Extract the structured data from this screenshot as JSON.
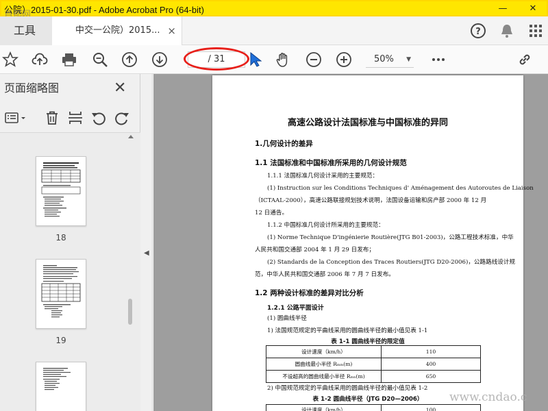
{
  "window": {
    "title": "公院）2015-01-30.pdf - Adobe Acrobat Pro (64-bit)",
    "minimize": "—",
    "close": "✕"
  },
  "tabs": {
    "tools": "工具",
    "document": "中交一公院）2015...",
    "close": "×"
  },
  "toolbar": {
    "page_value": "/ 31",
    "zoom_value": "50%"
  },
  "sidebar": {
    "title": "页面缩略图",
    "close": "✕",
    "thumbnails": [
      {
        "label": "18"
      },
      {
        "label": "19"
      }
    ]
  },
  "document": {
    "title": "高速公路设计法国标准与中国标准的异同",
    "section_1": "1.几何设计的差异",
    "section_1_1": "1.1 法国标准和中国标准所采用的几何设计规范",
    "p_1_1_1": "1.1.1  法国标准几何设计采用的主要规范：",
    "p_fr_1": "(1) Instruction sur les Conditions Techniques d' Aménagement des Autoroutes de Liaison",
    "p_fr_2": "（ICTAAL-2000），高速公路联接规划技术说明，法国设备运输和房产部 2000 年 12 月",
    "p_fr_3": "12 日通告。",
    "p_1_1_2": "1.1.2  中国标准几何设计所采用的主要规范：",
    "p_cn_1": "(1) Norme Technique D'ingénierie Routière(JTG B01-2003)，公路工程技术标准，中华",
    "p_cn_2": "人民共和国交通部 2004 年 1 月 29 日发布；",
    "p_cn_3": "(2) Standards de la Conception des Traces Routiers(JTG D20-2006)，公路路线设计规",
    "p_cn_4": "范，中华人民共和国交通部 2006 年 7 月 7 日发布。",
    "section_1_2": "1.2 两种设计标准的差异对比分析",
    "section_1_2_1": "1.2.1  公路平面设计",
    "p_curve": "(1) 圆曲线半径",
    "p_fr_rule": "1)  法国规范规定的平曲线采用的圆曲线半径的最小值见表 1-1",
    "table1_caption": "表 1-1    圆曲线半径的限定值",
    "table1": [
      [
        "设计速度（km/h）",
        "110"
      ],
      [
        "圆曲线最小半径 Rₘₘ(m)",
        "400"
      ],
      [
        "不设超高的圆曲线最小半径 Rₘₙ(m)",
        "650"
      ]
    ],
    "p_cn_rule": "2)  中国规范规定的平曲线采用的圆曲线半径的最小值见表 1-2",
    "table2_caption": "表 1-2    圆曲线半径（JTG D20—2006）",
    "table2_row": [
      "设计速度（km/h）",
      "100"
    ]
  },
  "watermarks": {
    "top_left": "首都网",
    "bottom_right": "www.cndao.c"
  },
  "colors": {
    "titlebar": "#ffe600",
    "highlight_ellipse": "#e8201a"
  }
}
